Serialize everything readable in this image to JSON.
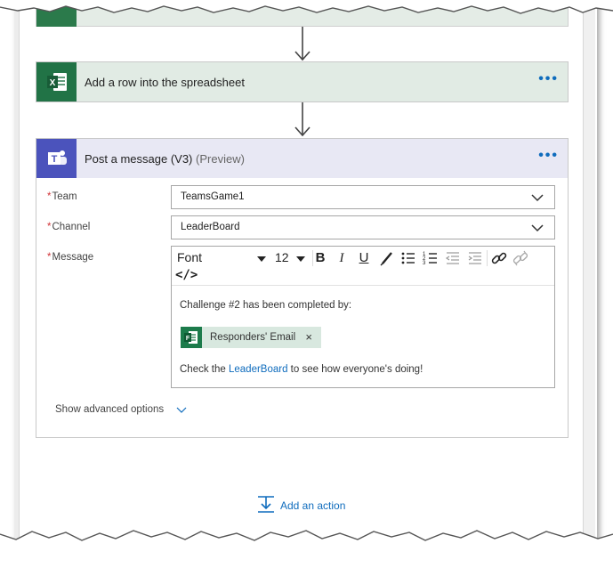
{
  "excel_step": {
    "title": "Add a row into the spreadsheet",
    "more": "•••"
  },
  "teams_step": {
    "title": "Post a message (V3)",
    "title_suffix": "(Preview)",
    "more": "•••",
    "fields": {
      "team": {
        "label": "Team",
        "required": "*",
        "value": "TeamsGame1"
      },
      "channel": {
        "label": "Channel",
        "required": "*",
        "value": "LeaderBoard"
      },
      "message": {
        "label": "Message",
        "required": "*"
      }
    },
    "toolbar": {
      "font": "Font",
      "size": "12",
      "bold": "B",
      "italic": "I",
      "underline": "U",
      "code_view": "</>"
    },
    "message_body": {
      "line1": "Challenge #2 has been completed by:",
      "token_label": "Responders' Email",
      "token_remove": "×",
      "line3_pre": "Check the ",
      "line3_link": "LeaderBoard",
      "line3_post": "  to see how everyone's doing!"
    },
    "advanced_label": "Show advanced options"
  },
  "add_action_label": "Add an action",
  "colors": {
    "excel_green": "#217346",
    "teams_purple": "#4b53bc",
    "link_blue": "#0f6cbd",
    "required_red": "#d13438"
  }
}
